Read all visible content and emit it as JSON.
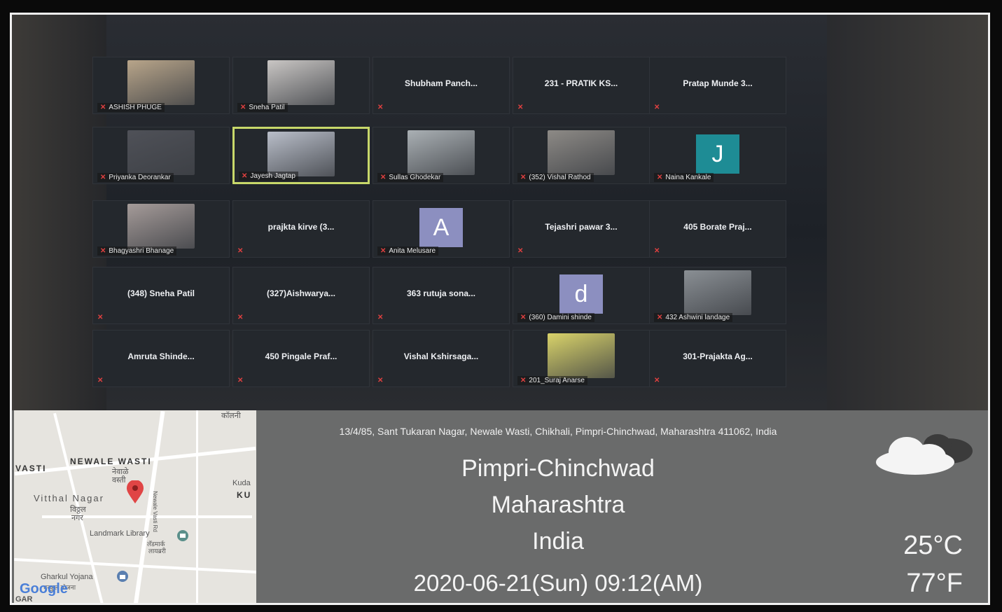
{
  "meeting": {
    "tiles": [
      {
        "name": "ASHISH PHUGE",
        "kind": "photo",
        "photo_color": "#b8a58a"
      },
      {
        "name": "Sneha Patil",
        "kind": "photo",
        "photo_color": "#c9c6c4"
      },
      {
        "name": "Shubham  Panch...",
        "kind": "name"
      },
      {
        "name": "231 - PRATIK KS...",
        "kind": "name"
      },
      {
        "name": "Pratap Munde 3...",
        "kind": "name"
      },
      {
        "name": "Priyanka Deorankar",
        "kind": "photo",
        "photo_color": "#4f5158"
      },
      {
        "name": "Jayesh Jagtap",
        "kind": "photo",
        "photo_color": "#b9bec9",
        "active": true
      },
      {
        "name": "Sullas Ghodekar",
        "kind": "photo",
        "photo_color": "#aab0b4"
      },
      {
        "name": "(352) Vishal Rathod",
        "kind": "photo",
        "photo_color": "#8d8a86"
      },
      {
        "name": "Naina Kankale",
        "kind": "avatar",
        "letter": "J",
        "avatar_color": "#1e8c95"
      },
      {
        "name": "Bhagyashri Bhanage",
        "kind": "photo",
        "photo_color": "#a59b99"
      },
      {
        "name": "prajkta kirve (3...",
        "kind": "name"
      },
      {
        "name": "Anita Melusare",
        "kind": "avatar",
        "letter": "A",
        "avatar_color": "#8c8fc0"
      },
      {
        "name": "Tejashri pawar 3...",
        "kind": "name"
      },
      {
        "name": "405 Borate Praj...",
        "kind": "name"
      },
      {
        "name": "(348) Sneha Patil",
        "kind": "name"
      },
      {
        "name": "(327)Aishwarya...",
        "kind": "name"
      },
      {
        "name": "363 rutuja sona...",
        "kind": "name"
      },
      {
        "name": "(360) Damini shinde",
        "kind": "avatar",
        "letter": "d",
        "avatar_color": "#8c8fc0"
      },
      {
        "name": "432 Ashwini landage",
        "kind": "photo",
        "photo_color": "#8a8f94"
      },
      {
        "name": "Amruta  Shinde...",
        "kind": "name"
      },
      {
        "name": "450 Pingale Praf...",
        "kind": "name"
      },
      {
        "name": "Vishal Kshirsaga...",
        "kind": "name"
      },
      {
        "name": "201_Suraj Anarse",
        "kind": "photo",
        "photo_color": "#d9d36a"
      },
      {
        "name": "301-Prajakta Ag...",
        "kind": "name"
      }
    ]
  },
  "geotag": {
    "map": {
      "labels": [
        "कॉलनी",
        "NEWALE WASTI",
        "नेवाळे",
        "वस्ती",
        "VASTI",
        "Vitthal Nagar",
        "विठ्ठल",
        "नगर",
        "Kuda",
        "KU",
        "Newale Vasti Rd",
        "Landmark Library",
        "लँडमार्क",
        "लायब्ररी",
        "Gharkul Yojana",
        "घरकुल योजना",
        "GAR",
        "Google"
      ]
    },
    "address": "13/4/85, Sant Tukaran Nagar, Newale Wasti, Chikhali, Pimpri-Chinchwad, Maharashtra 411062, India",
    "city": "Pimpri-Chinchwad",
    "state": "Maharashtra",
    "country": "India",
    "datetime": "2020-06-21(Sun)   09:12(AM)",
    "temp_c": "25°C",
    "temp_f": "77°F",
    "weather_icon": "partly-cloudy-icon"
  }
}
